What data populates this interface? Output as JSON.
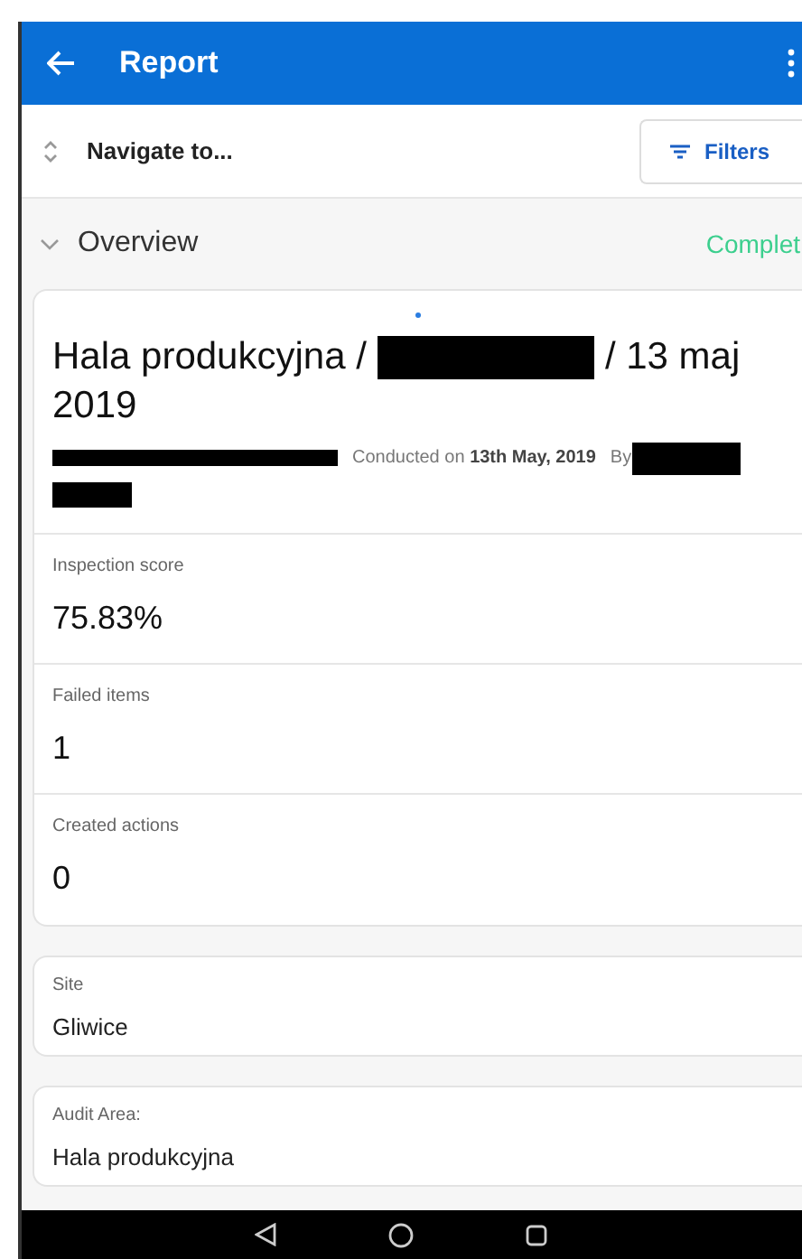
{
  "app_bar": {
    "title": "Report"
  },
  "toolbar": {
    "navigate": "Navigate to...",
    "filters": "Filters"
  },
  "section": {
    "title": "Overview",
    "expanded": true,
    "status": "Complet"
  },
  "header": {
    "title_start": "Hala produkcyjna /",
    "title_end": "/ 13 maj",
    "title_year": "2019",
    "conducted": "Conducted on **13th May, 2019**",
    "by": "By"
  },
  "stats": [
    {
      "label": "Inspection score",
      "value": "75.83%"
    },
    {
      "label": "Failed items",
      "value": "1"
    },
    {
      "label": "Created actions",
      "value": "0"
    }
  ],
  "fields": [
    {
      "label": "Site",
      "value": "Gliwice"
    },
    {
      "label": "Audit Area:",
      "value": "Hala produkcyjna"
    }
  ]
}
